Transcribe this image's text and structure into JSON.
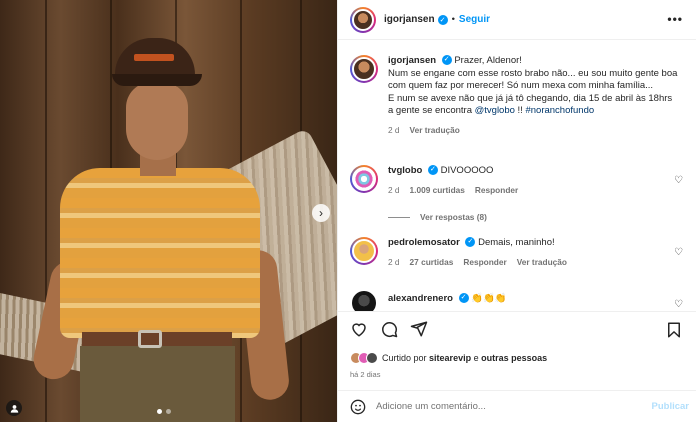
{
  "post": {
    "username": "igorjansen",
    "follow_label": "Seguir",
    "separator": "•",
    "more_label": "•••"
  },
  "photo": {
    "alt": "Igor Jansen em cena de No Rancho Fundo",
    "slide_index": 1,
    "slide_count": 2
  },
  "caption": {
    "username": "igorjansen",
    "line1": "Prazer, Aldenor!",
    "line2": "Num se engane com esse rosto brabo não... eu sou muito gente boa com quem faz por merecer! Só num mexa com minha família...",
    "line3a": "E num se avexe não que já já tô chegando, dia 15 de abril às 18hrs a gente se encontra",
    "mention": "@tvglobo",
    "exclaim": "!!",
    "hashtag": "#noranchofundo",
    "time": "2 d",
    "translate": "Ver tradução"
  },
  "comments": [
    {
      "username": "tvglobo",
      "text": "DIVOOOOO",
      "time": "2 d",
      "likes": "1.009 curtidas",
      "reply": "Responder",
      "view_replies": "Ver respostas (8)"
    },
    {
      "username": "pedrolemosator",
      "text": "Demais, maninho!",
      "time": "2 d",
      "likes": "27 curtidas",
      "reply": "Responder",
      "translate": "Ver tradução"
    },
    {
      "username": "alexandrenero",
      "text": "👏👏👏"
    }
  ],
  "footer": {
    "liked_prefix": "Curtido por",
    "liked_user": "sitearevip",
    "liked_suffix": "e",
    "liked_others": "outras pessoas",
    "time_ago": "há 2 dias",
    "comment_placeholder": "Adicione um comentário...",
    "publish_label": "Publicar"
  },
  "colors": {
    "accent_blue": "#0095f6",
    "publish_disabled": "#b2dffc",
    "secondary_text": "#737373"
  },
  "icons": [
    "heart-icon",
    "comment-icon",
    "share-icon",
    "bookmark-icon",
    "emoji-icon",
    "verified-icon",
    "more-icon",
    "chevron-right-icon",
    "tag-user-icon"
  ]
}
